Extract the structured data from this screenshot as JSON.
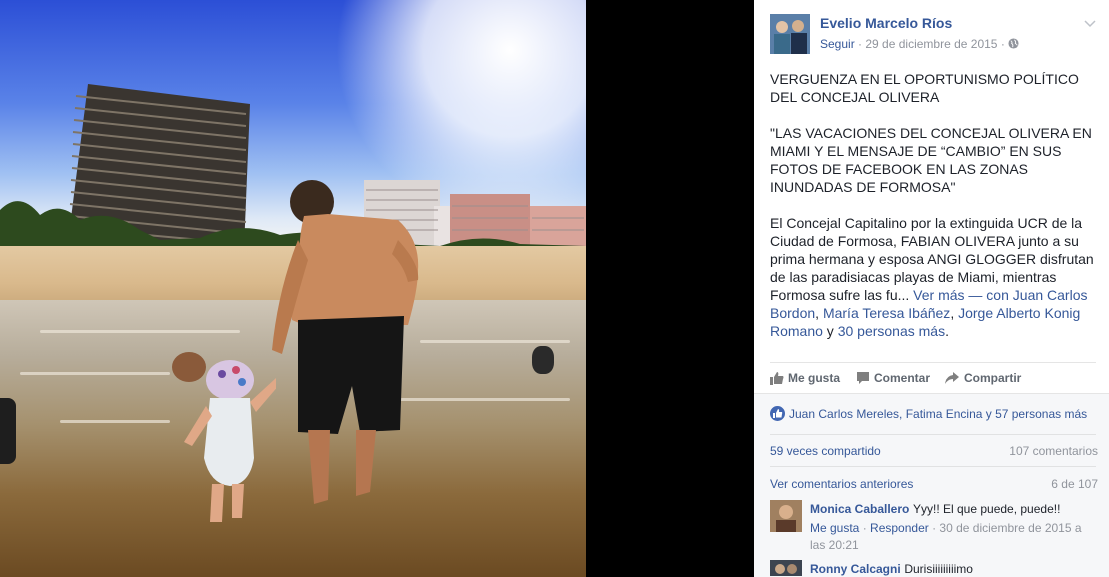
{
  "post": {
    "author": "Evelio Marcelo Ríos",
    "follow": "Seguir",
    "date": "29 de diciembre de 2015",
    "paragraphs": [
      "VERGUENZA EN EL OPORTUNISMO POLÍTICO DEL CONCEJAL OLIVERA",
      "\"LAS VACACIONES DEL CONCEJAL OLIVERA EN MIAMI Y EL MENSAJE DE “CAMBIO” EN SUS FOTOS DE FACEBOOK EN LAS ZONAS INUNDADAS DE FORMOSA\""
    ],
    "body": "El Concejal Capitalino por la extinguida UCR de la Ciudad de Formosa, FABIAN OLIVERA junto a su prima hermana y esposa ANGI GLOGGER disfrutan de las paradisiacas playas de Miami, mientras Formosa sufre las fu...",
    "see_more": "Ver más",
    "with_prefix": " — con",
    "tagged": [
      "Juan Carlos Bordon",
      "María Teresa Ibáñez",
      "Jorge Alberto Konig Romano"
    ],
    "sep_comma": ",",
    "and": " y ",
    "more_people": "30 personas más",
    "period": "."
  },
  "actions": {
    "like": "Me gusta",
    "comment": "Comentar",
    "share": "Compartir"
  },
  "feedback": {
    "likes_text": "Juan Carlos Mereles, Fatima Encina y 57 personas más",
    "shares": "59 veces compartido",
    "comments_count": "107 comentarios",
    "view_previous": "Ver comentarios anteriores",
    "pager": "6 de 107"
  },
  "comments": [
    {
      "name": "Monica Caballero",
      "text": "Yyy!! El que puede, puede!!",
      "like": "Me gusta",
      "reply": "Responder",
      "date": "30 de diciembre de 2015 a las 20:21"
    },
    {
      "name": "Ronny Calcagni",
      "text": "Durisiiiiiiiiimo"
    }
  ],
  "colors": {
    "link": "#365899",
    "meta": "#90949c",
    "like_blue": "#4267b2"
  },
  "icons": {
    "globe": "globe-icon",
    "chevron": "chevron-down-icon",
    "like": "thumbs-up-icon",
    "comment": "speech-bubble-icon",
    "share": "share-arrow-icon"
  }
}
